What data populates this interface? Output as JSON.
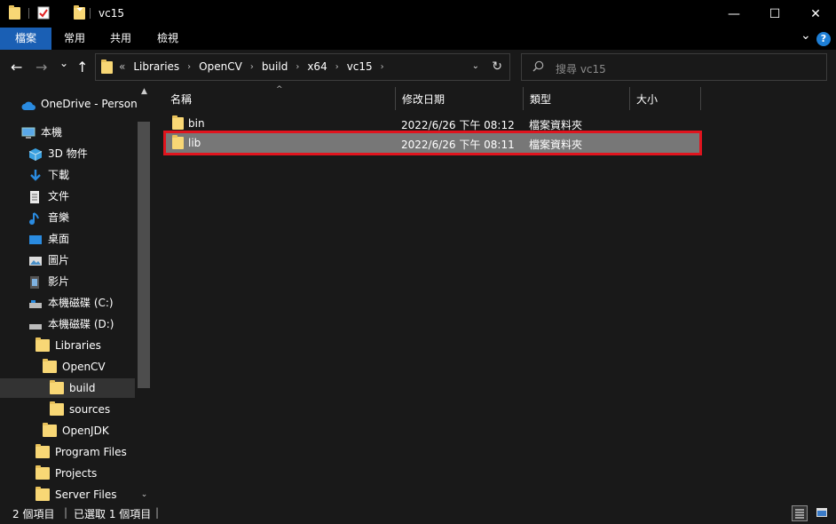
{
  "window": {
    "title": "vc15",
    "minimize_glyph": "—",
    "maximize_glyph": "☐",
    "close_glyph": "✕"
  },
  "ribbon": {
    "tabs": [
      "檔案",
      "常用",
      "共用",
      "檢視"
    ],
    "expand_glyph": "⌄",
    "help_glyph": "?"
  },
  "address": {
    "back_glyph": "←",
    "forward_glyph": "→",
    "recent_glyph": "⌄",
    "up_glyph": "↑",
    "overflow": "«",
    "crumbs": [
      "Libraries",
      "OpenCV",
      "build",
      "x64",
      "vc15"
    ],
    "separator": "›",
    "refresh_glyph": "↻",
    "dropdown_glyph": "⌄"
  },
  "search": {
    "placeholder": "搜尋 vc15"
  },
  "nav": {
    "items": [
      {
        "label": "OneDrive - Persona",
        "icon": "cloud-icon"
      },
      {
        "label": "本機",
        "icon": "computer-icon"
      },
      {
        "label": "3D 物件",
        "icon": "cube-icon"
      },
      {
        "label": "下載",
        "icon": "download-icon"
      },
      {
        "label": "文件",
        "icon": "document-icon"
      },
      {
        "label": "音樂",
        "icon": "music-icon"
      },
      {
        "label": "桌面",
        "icon": "desktop-icon"
      },
      {
        "label": "圖片",
        "icon": "pictures-icon"
      },
      {
        "label": "影片",
        "icon": "video-icon"
      },
      {
        "label": "本機磁碟 (C:)",
        "icon": "drive-icon"
      },
      {
        "label": "本機磁碟 (D:)",
        "icon": "drive-icon"
      },
      {
        "label": "Libraries",
        "icon": "folder-icon"
      },
      {
        "label": "OpenCV",
        "icon": "folder-icon"
      },
      {
        "label": "build",
        "icon": "folder-icon"
      },
      {
        "label": "sources",
        "icon": "folder-icon"
      },
      {
        "label": "OpenJDK",
        "icon": "folder-icon"
      },
      {
        "label": "Program Files",
        "icon": "folder-icon"
      },
      {
        "label": "Projects",
        "icon": "folder-icon"
      },
      {
        "label": "Server Files",
        "icon": "folder-icon"
      }
    ],
    "scroll_up": "▲",
    "scroll_down": "⌄"
  },
  "columns": {
    "name": "名稱",
    "modified": "修改日期",
    "type": "類型",
    "size": "大小",
    "sort_glyph": "^"
  },
  "files": [
    {
      "name": "bin",
      "modified": "2022/6/26 下午 08:12",
      "type": "檔案資料夾",
      "size": ""
    },
    {
      "name": "lib",
      "modified": "2022/6/26 下午 08:11",
      "type": "檔案資料夾",
      "size": ""
    }
  ],
  "status": {
    "count": "2 個項目",
    "selection": "已選取 1 個項目"
  },
  "colors": {
    "accent": "#1a5fb4",
    "folder": "#f8d775",
    "highlight": "#e0141e",
    "selected_row": "#777777"
  }
}
